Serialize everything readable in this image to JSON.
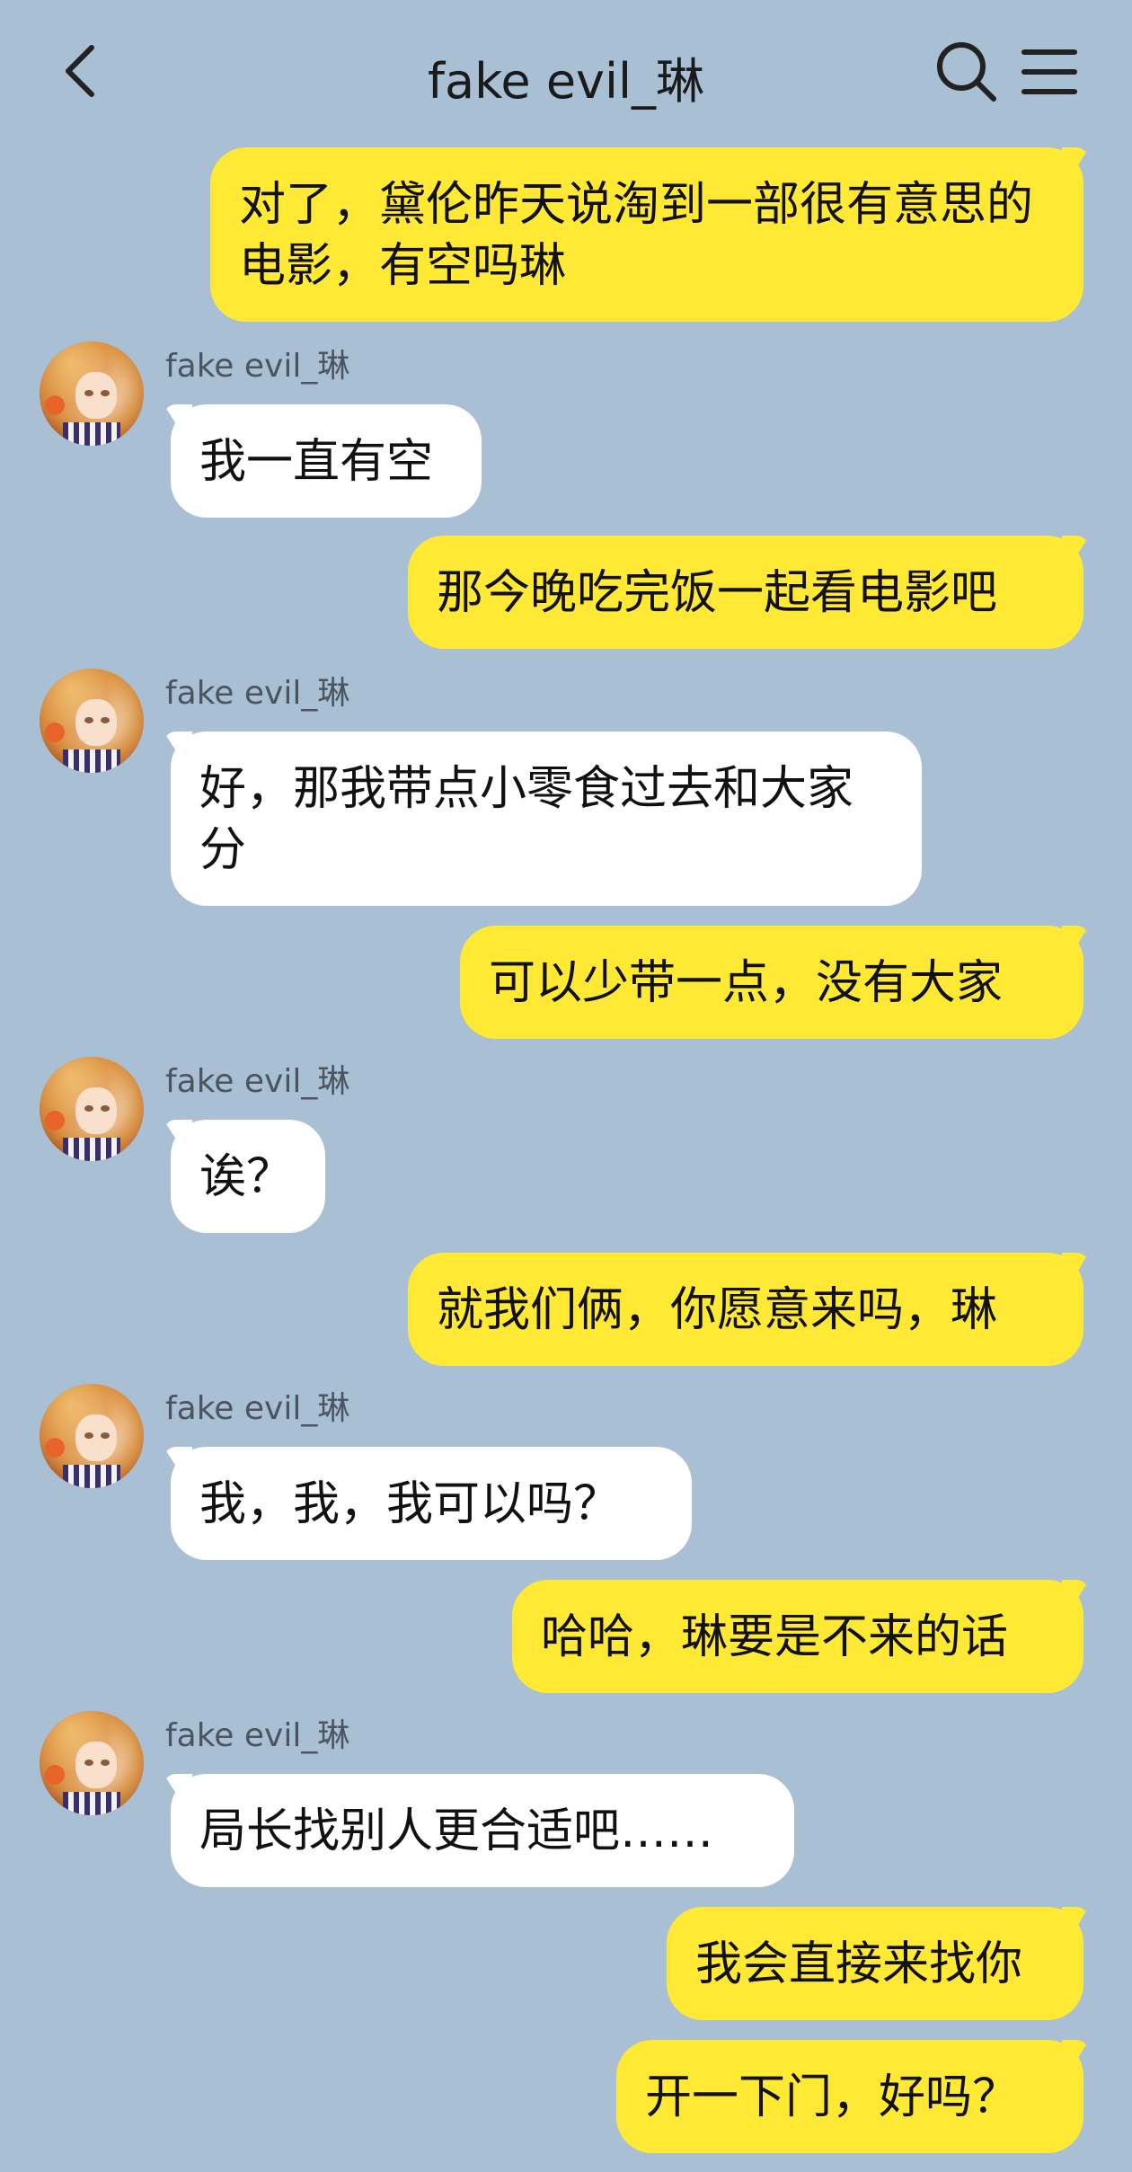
{
  "header": {
    "title": "fake evil_琳"
  },
  "messages": [
    {
      "dir": "out",
      "text": "对了，黛伦昨天说淘到一部很有意思的电影，有空吗琳"
    },
    {
      "dir": "in",
      "sender": "fake evil_琳",
      "text": "我一直有空"
    },
    {
      "dir": "out",
      "text": "那今晚吃完饭一起看电影吧"
    },
    {
      "dir": "in",
      "sender": "fake evil_琳",
      "text": "好，那我带点小零食过去和大家分"
    },
    {
      "dir": "out",
      "text": "可以少带一点，没有大家"
    },
    {
      "dir": "in",
      "sender": "fake evil_琳",
      "text": "诶？"
    },
    {
      "dir": "out",
      "text": "就我们俩，你愿意来吗，琳"
    },
    {
      "dir": "in",
      "sender": "fake evil_琳",
      "text": "我，我，我可以吗？"
    },
    {
      "dir": "out",
      "text": "哈哈，琳要是不来的话"
    },
    {
      "dir": "in",
      "sender": "fake evil_琳",
      "text": "局长找别人更合适吧……"
    },
    {
      "dir": "out",
      "text": "我会直接来找你"
    },
    {
      "dir": "out",
      "text": "开一下门，好吗？"
    }
  ],
  "colors": {
    "background": "#a9bfd3",
    "outgoing_bubble": "#ffe935",
    "incoming_bubble": "#ffffff"
  },
  "icons": {
    "back": "chevron-left-icon",
    "search": "search-icon",
    "menu": "menu-icon"
  }
}
